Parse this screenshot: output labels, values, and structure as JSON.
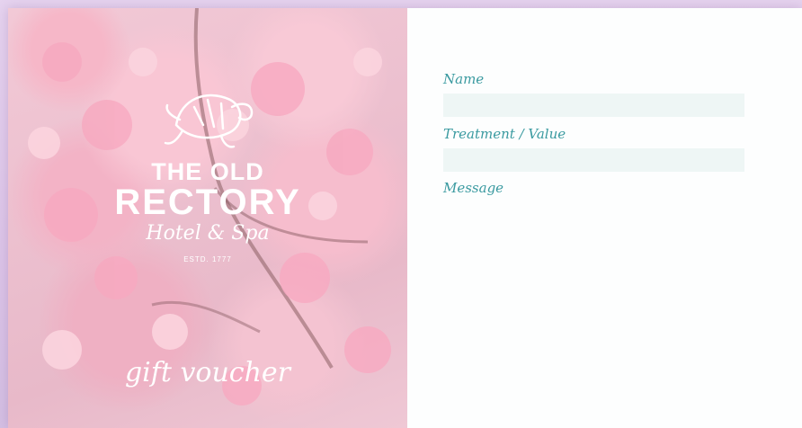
{
  "brand": {
    "line1": "THE OLD",
    "line2": "RECTORY",
    "line3": "Hotel & Spa",
    "established": "ESTD. 1777",
    "logo_icon": "turtle-icon"
  },
  "voucher_title": "gift voucher",
  "form": {
    "name_label": "Name",
    "treatment_label": "Treatment / Value",
    "message_label": "Message"
  },
  "colors": {
    "label": "#3a9aa0",
    "field_background": "#eef6f5",
    "page_background": "#dcc4e8"
  }
}
